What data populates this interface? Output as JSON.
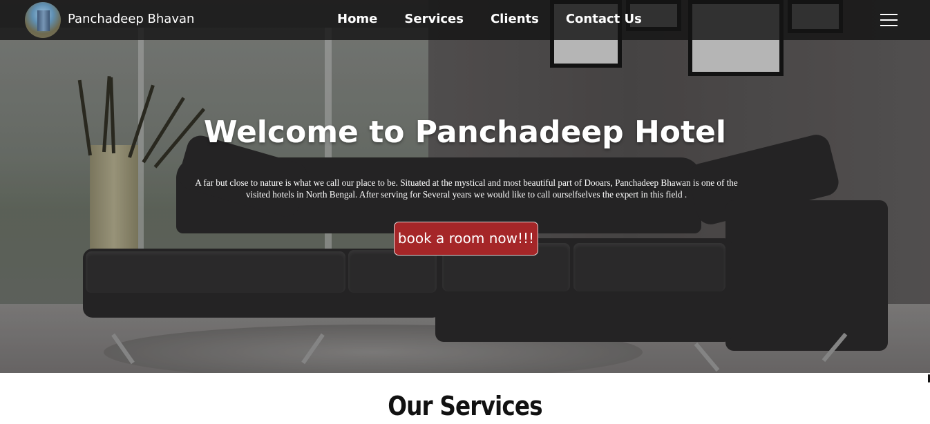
{
  "navbar": {
    "brand_name": "Panchadeep Bhavan",
    "links": [
      "Home",
      "Services",
      "Clients",
      "Contact Us"
    ],
    "menu_icon": "hamburger-menu-icon"
  },
  "hero": {
    "title": "Welcome to Panchadeep Hotel",
    "description": "A far but close to nature is what we call our place to be. Situated at the mystical and most beautiful part of Dooars, Panchadeep Bhawan is one of the visited hotels in North Bengal. After serving for Several years we would like to call ourselfselves the expert in this field .",
    "cta_label": "book a room now!!!",
    "cta_color": "#a52628"
  },
  "services": {
    "title": "Our Services"
  }
}
